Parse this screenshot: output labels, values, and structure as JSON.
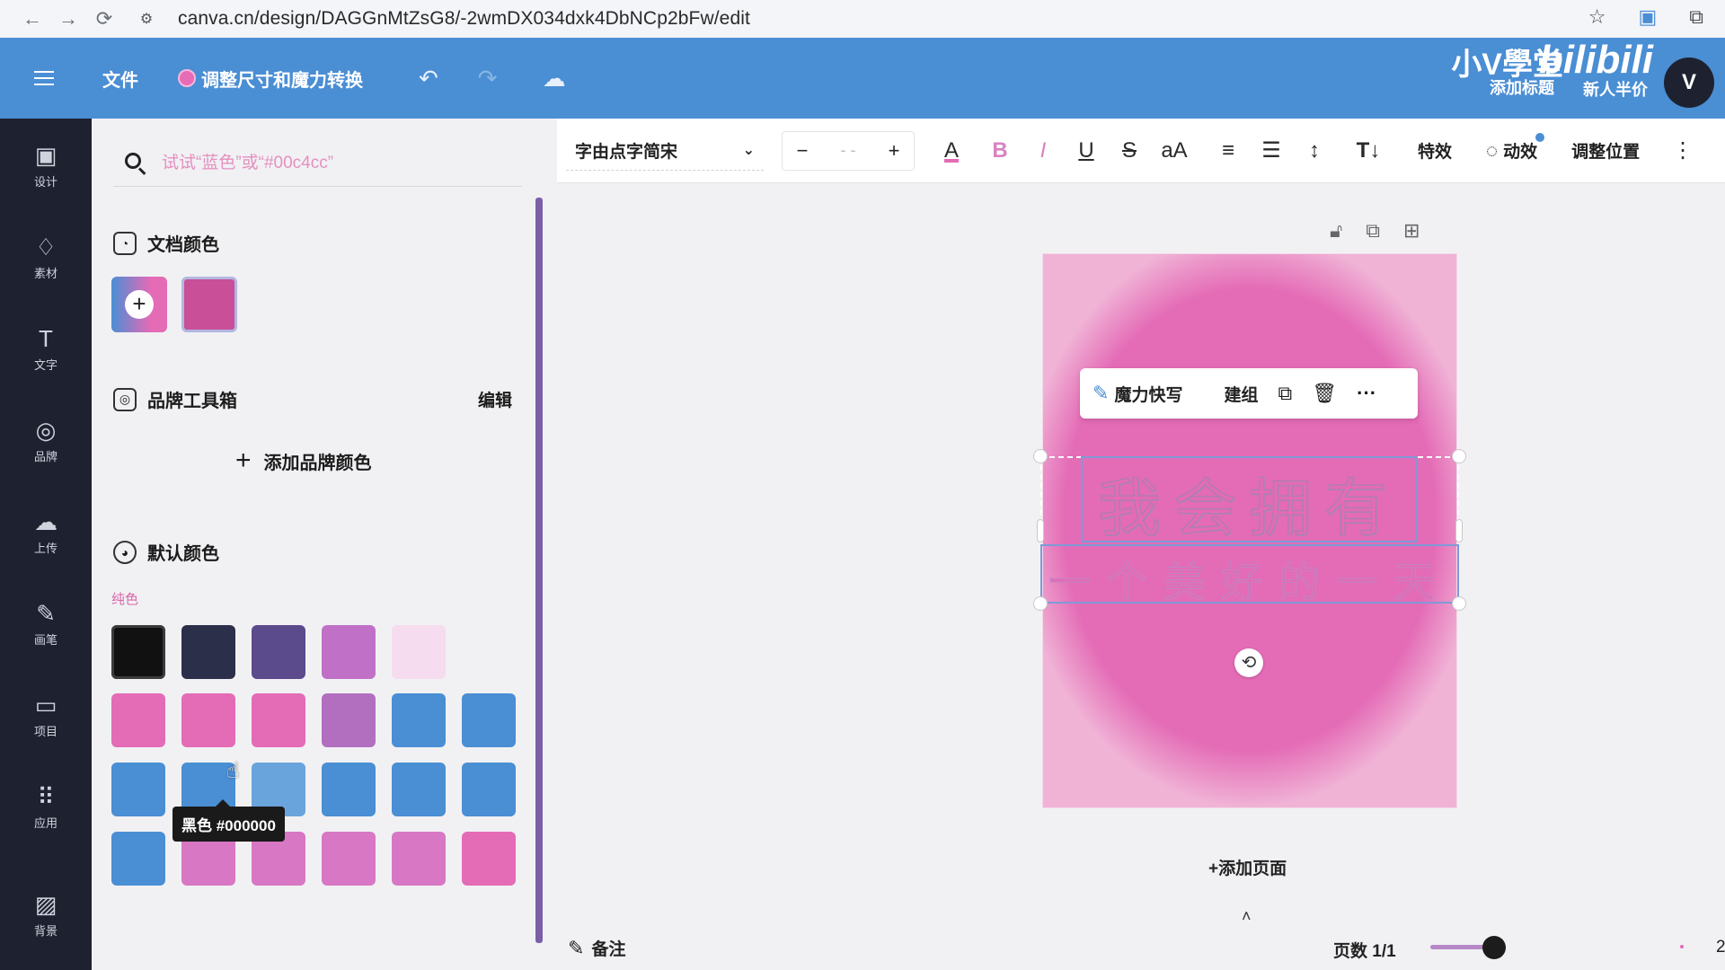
{
  "browser": {
    "url": "canva.cn/design/DAGGnMtZsG8/-2wmDX034dxk4DbNCp2bFw/edit"
  },
  "topbar": {
    "file_label": "文件",
    "magic_label": "调整尺寸和魔力转换",
    "add_title": "添加标题",
    "watermark": "小V學堂",
    "brand_logo": "bilibili",
    "extra_label": "新人半价",
    "avatar_letter": "V"
  },
  "rail": {
    "items": [
      {
        "label": "设计",
        "icon": "design-icon"
      },
      {
        "label": "素材",
        "icon": "elements-icon"
      },
      {
        "label": "文字",
        "icon": "text-icon"
      },
      {
        "label": "品牌",
        "icon": "brand-icon"
      },
      {
        "label": "上传",
        "icon": "upload-icon"
      },
      {
        "label": "画笔",
        "icon": "draw-icon"
      },
      {
        "label": "项目",
        "icon": "projects-icon"
      },
      {
        "label": "应用",
        "icon": "apps-icon"
      },
      {
        "label": "背景",
        "icon": "background-icon"
      }
    ]
  },
  "panel": {
    "search_placeholder": "试试“蓝色”或“#00c4cc”",
    "doc_colors_title": "文档颜色",
    "brand_kit_title": "品牌工具箱",
    "brand_edit": "编辑",
    "add_brand_color": "添加品牌颜色",
    "default_colors_title": "默认颜色",
    "solid_label": "纯色",
    "tooltip": "黑色 #000000",
    "doc_swatch_color": "#c84f98",
    "swatch_rows": [
      [
        "#111111",
        "#2b2f4a",
        "#5b4a8c",
        "#c071c7",
        "#f6dcef"
      ],
      [
        "#e46bb6",
        "#e46bb6",
        "#e46bb6",
        "#b26fc0",
        "#4a8ed4",
        "#4a8ed4"
      ],
      [
        "#4a8ed4",
        "#4a8ed4",
        "#6aa4dc",
        "#4a8ed4",
        "#4a8ed4",
        "#4a8ed4"
      ],
      [
        "#4a8ed4",
        "#d877c3",
        "#d877c3",
        "#d877c3",
        "#d877c3",
        "#e46bb6"
      ]
    ]
  },
  "toolbar": {
    "font_name": "字由点字简宋",
    "size_minus": "−",
    "size_value": "- -",
    "size_plus": "+",
    "effects": "特效",
    "animate": "动效",
    "position": "调整位置"
  },
  "canvas": {
    "ctx_magic": "魔力快写",
    "ctx_group": "建组",
    "headline": "我会拥有",
    "subline": "一个美好的一天",
    "add_page": "+添加页面"
  },
  "footer": {
    "notes": "备注",
    "page_count": "页数 1/1",
    "zoom_partial": "2"
  }
}
